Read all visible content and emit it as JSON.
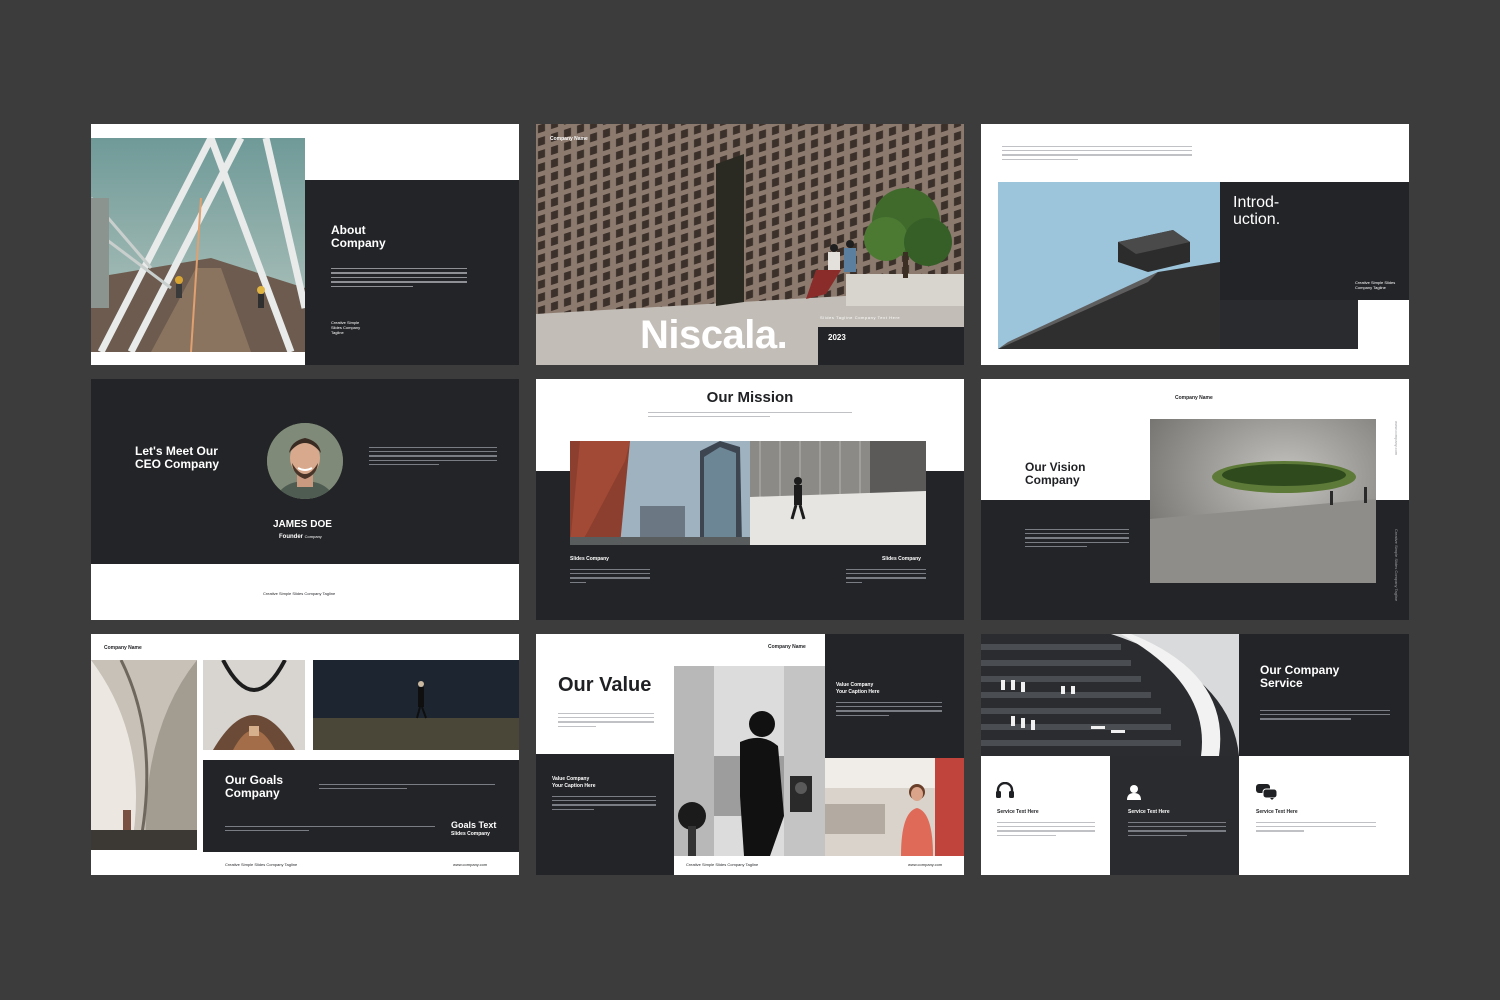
{
  "slides": {
    "about": {
      "title": "About Company",
      "tagline": "Creative Simple Slides Company Tagline"
    },
    "cover": {
      "company": "Company Name",
      "title": "Niscala.",
      "tagline": "Slides Tagline Company Text Here",
      "year": "2023"
    },
    "intro": {
      "title": "Introd- uction.",
      "tagline": "Creative Simple Slides Company Tagline"
    },
    "ceo": {
      "title": "Let's Meet Our CEO Company",
      "name": "JAMES DOE",
      "role": "Founder",
      "role_suffix": "Company",
      "tagline": "Creative Simple Slides Company Tagline"
    },
    "mission": {
      "title": "Our Mission",
      "left_label": "Slides Company",
      "right_label": "Slides Company"
    },
    "vision": {
      "company": "Company Name",
      "title": "Our Vision Company",
      "side_top": "www.company.com",
      "side_bottom": "Creative Simple Slides Company Tagline"
    },
    "goals": {
      "company": "Company Name",
      "title": "Our Goals Company",
      "goals_text": "Goals Text",
      "goals_sub": "Slides Company",
      "tagline": "Creative Simple Slides Company Tagline",
      "url": "www.company.com"
    },
    "value": {
      "company": "Company Name",
      "title": "Our Value",
      "caption_left_1": "Value Company",
      "caption_left_2": "Your Caption Here",
      "caption_right_1": "Value Company",
      "caption_right_2": "Your Caption Here",
      "tagline": "Creative Simple Slides Company Tagline",
      "url": "www.company.com"
    },
    "service": {
      "title": "Our Company Service",
      "items": [
        {
          "label": "Service Text Here",
          "icon": "headset-icon"
        },
        {
          "label": "Service Text Here",
          "icon": "user-icon"
        },
        {
          "label": "Service Text Here",
          "icon": "chat-icon"
        }
      ]
    }
  },
  "colors": {
    "background": "#3c3c3c",
    "dark": "#232427",
    "white": "#ffffff"
  }
}
